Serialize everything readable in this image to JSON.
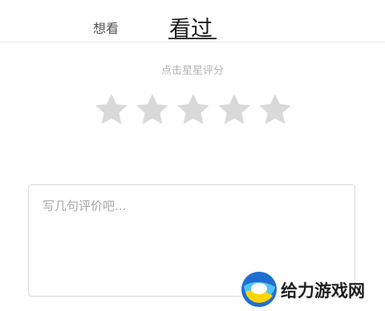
{
  "tabs": {
    "want_label": "想看",
    "seen_label": "看过",
    "active": "seen"
  },
  "rating": {
    "hint": "点击星星评分",
    "max_stars": 5,
    "selected": 0,
    "star_color": "#d9d9d9"
  },
  "review": {
    "value": "",
    "placeholder": "写几句评价吧..."
  },
  "watermark": {
    "text": "给力游戏网",
    "icon": "circle-swirl-logo"
  }
}
